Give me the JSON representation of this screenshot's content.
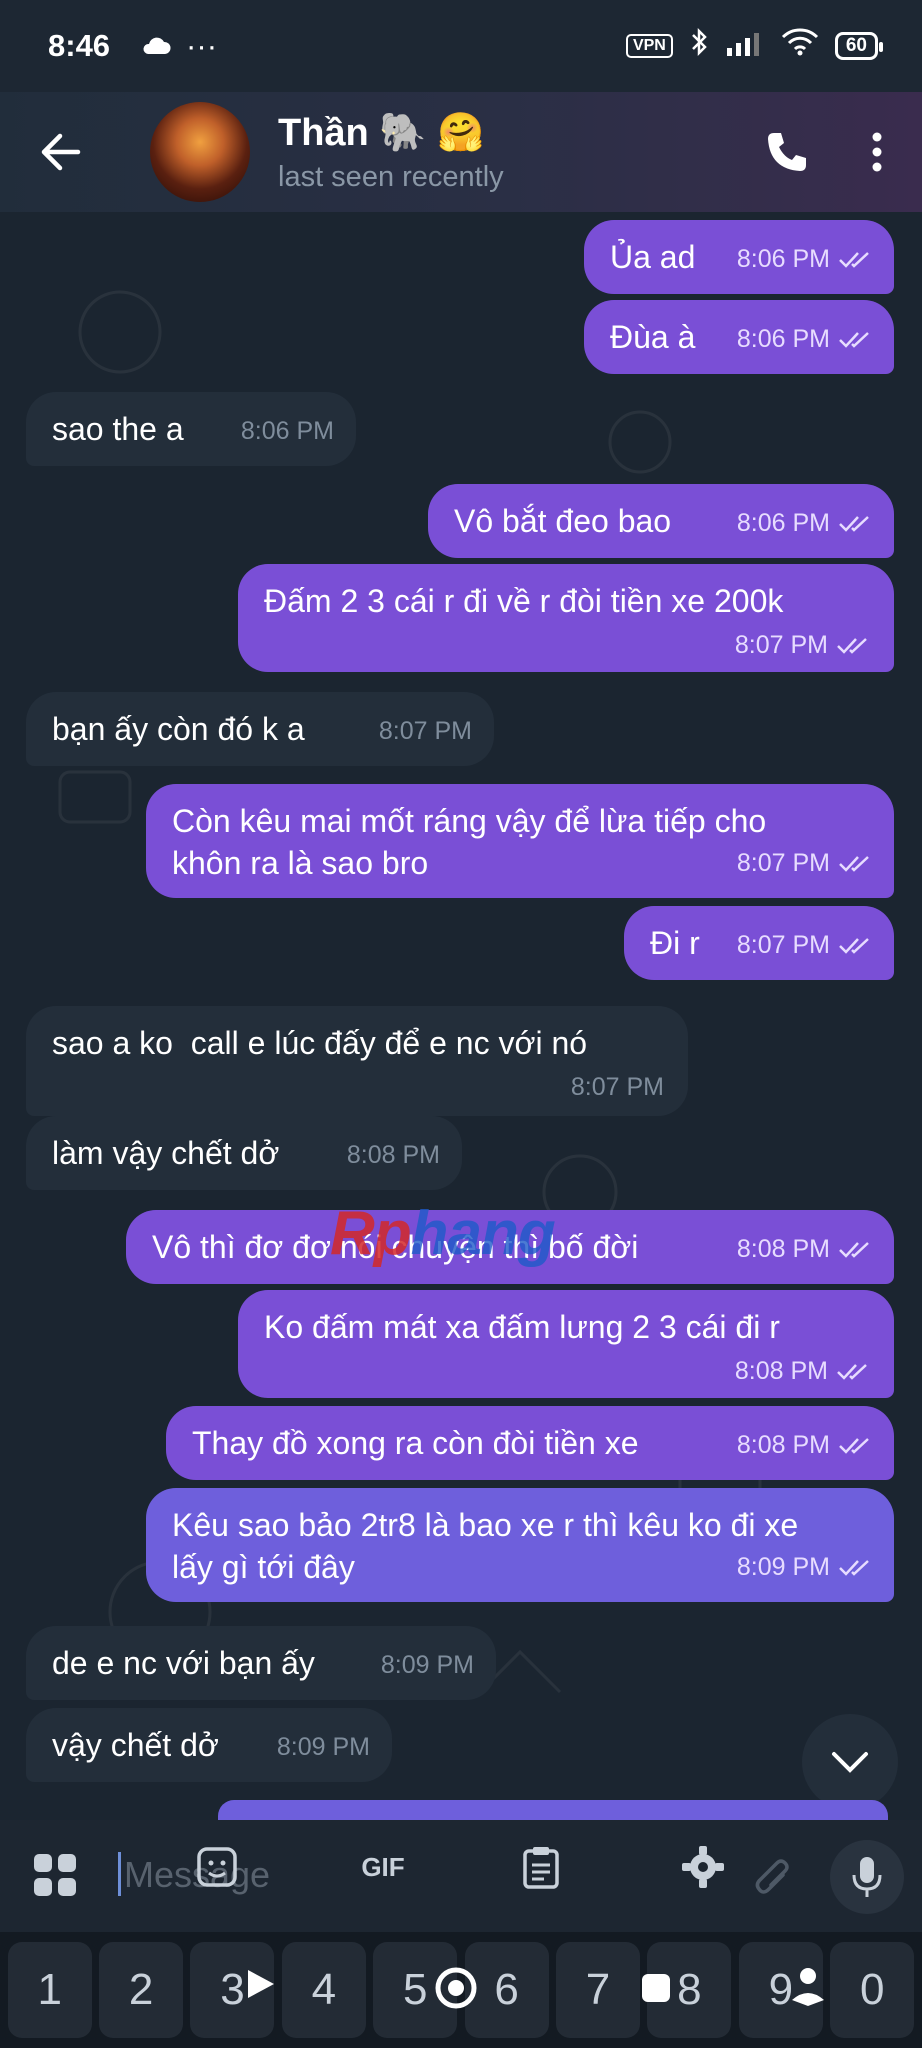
{
  "status_bar": {
    "time": "8:46",
    "dots": "···",
    "vpn": "VPN",
    "battery": "60"
  },
  "header": {
    "title": "Thần 🐘 🤗",
    "status": "last seen recently"
  },
  "messages": [
    {
      "dir": "out",
      "text": "Ủa ad",
      "time": "8:06 PM"
    },
    {
      "dir": "out",
      "text": "Đùa à",
      "time": "8:06 PM"
    },
    {
      "dir": "in",
      "text": "sao the a",
      "time": "8:06 PM"
    },
    {
      "dir": "out",
      "text": "Vô bắt đeo bao",
      "time": "8:06 PM"
    },
    {
      "dir": "out",
      "text": "Đấm 2 3 cái r đi về r đòi tiền xe 200k",
      "time": "8:07 PM"
    },
    {
      "dir": "in",
      "text": "bạn ấy còn đó k a",
      "time": "8:07 PM"
    },
    {
      "dir": "out",
      "text": "Còn kêu mai mốt ráng vậy để lừa tiếp cho\nkhôn ra là sao bro",
      "time": "8:07 PM"
    },
    {
      "dir": "out",
      "text": "Đi r",
      "time": "8:07 PM"
    },
    {
      "dir": "in",
      "text": "sao a ko  call e lúc đấy để e nc với nó",
      "time": "8:07 PM"
    },
    {
      "dir": "in",
      "text": "làm vậy chết dở",
      "time": "8:08 PM"
    },
    {
      "dir": "out",
      "text": "Vô thì đơ đơ nói chuyện thì bố đời",
      "time": "8:08 PM"
    },
    {
      "dir": "out",
      "text": "Ko đấm mát xa đấm lưng 2 3 cái đi r",
      "time": "8:08 PM"
    },
    {
      "dir": "out",
      "text": "Thay đồ xong ra còn đòi tiền xe",
      "time": "8:08 PM"
    },
    {
      "dir": "out",
      "text": "Kêu sao bảo 2tr8 là bao xe r thì kêu ko đi xe\nlấy gì tới đây",
      "time": "8:09 PM"
    },
    {
      "dir": "in",
      "text": "de e nc với bạn ấy",
      "time": "8:09 PM"
    },
    {
      "dir": "in",
      "text": "vậy chết dở",
      "time": "8:09 PM"
    }
  ],
  "watermark": {
    "part1": "Rp",
    "part2": "hang"
  },
  "composer": {
    "placeholder": "Message",
    "gif_label": "GIF"
  },
  "keyboard": {
    "numbers": [
      "1",
      "2",
      "3",
      "4",
      "5",
      "6",
      "7",
      "8",
      "9",
      "0"
    ]
  },
  "colors": {
    "outgoing_bubble": "#7a4fd6",
    "incoming_bubble": "#232e3a",
    "background": "#1b2530"
  }
}
